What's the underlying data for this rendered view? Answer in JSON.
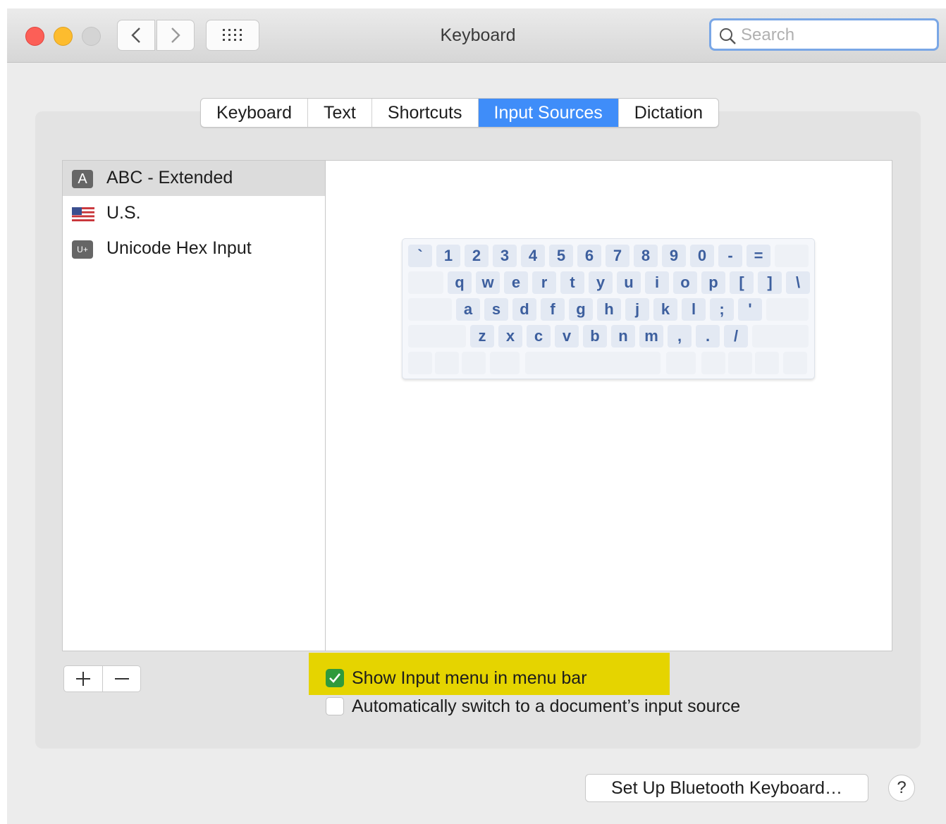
{
  "window": {
    "title": "Keyboard"
  },
  "search": {
    "placeholder": "Search",
    "value": ""
  },
  "tabs": [
    {
      "label": "Keyboard"
    },
    {
      "label": "Text"
    },
    {
      "label": "Shortcuts"
    },
    {
      "label": "Input Sources",
      "active": true
    },
    {
      "label": "Dictation"
    }
  ],
  "sources": [
    {
      "label": "ABC - Extended",
      "icon": "A",
      "selected": true
    },
    {
      "label": "U.S.",
      "icon": "us-flag-icon"
    },
    {
      "label": "Unicode Hex Input",
      "icon": "U+"
    }
  ],
  "keyboard": {
    "rows": [
      [
        "`",
        "1",
        "2",
        "3",
        "4",
        "5",
        "6",
        "7",
        "8",
        "9",
        "0",
        "-",
        "="
      ],
      [
        "q",
        "w",
        "e",
        "r",
        "t",
        "y",
        "u",
        "i",
        "o",
        "p",
        "[",
        "]",
        "\\"
      ],
      [
        "a",
        "s",
        "d",
        "f",
        "g",
        "h",
        "j",
        "k",
        "l",
        ";",
        "'"
      ],
      [
        "z",
        "x",
        "c",
        "v",
        "b",
        "n",
        "m",
        ",",
        ".",
        "/"
      ]
    ]
  },
  "options": {
    "show_input_menu": {
      "label": "Show Input menu in menu bar",
      "checked": true
    },
    "auto_switch": {
      "label": "Automatically switch to a document’s input source",
      "checked": false
    }
  },
  "buttons": {
    "bluetooth": "Set Up Bluetooth Keyboard…",
    "help": "?"
  },
  "colors": {
    "accent": "#3f8df9",
    "highlight": "#e5d400",
    "checkbox_on": "#2f9a3c",
    "key_text": "#3d5f9e"
  }
}
